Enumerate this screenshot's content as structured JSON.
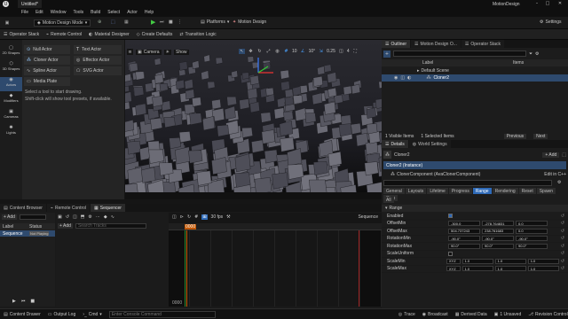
{
  "titlebar": {
    "tab": "Untitled*",
    "app_name": "MotionDesign"
  },
  "menu": [
    "File",
    "Edit",
    "Window",
    "Tools",
    "Build",
    "Select",
    "Actor",
    "Help"
  ],
  "toolbar1": {
    "mode": "Motion Design Mode",
    "platforms": "Platforms",
    "motion_design": "Motion Design",
    "settings": "Settings"
  },
  "toolbar2": {
    "items": [
      "Operator Stack",
      "Remote Control",
      "Material Designer",
      "Create Defaults",
      "Transition Logic"
    ]
  },
  "leftbar": [
    "2D Shapes",
    "3D Shapes",
    "Actors",
    "Modifiers",
    "Cameras",
    "Lights"
  ],
  "tools": {
    "items": [
      "Null Actor",
      "Text Actor",
      "Cloner Actor",
      "Effector Actor",
      "Spline Actor",
      "SVG Actor",
      "Media Plate"
    ],
    "hint1": "Select a tool to start drawing.",
    "hint2": "Shift-click will show tool presets, if available."
  },
  "viewport": {
    "camera": "Camera",
    "show": "Show",
    "snap1": "10",
    "snap2": "10°",
    "snap3": "0.25",
    "snap4": "4"
  },
  "outliner": {
    "tabs": [
      "Outliner",
      "Motion Design O...",
      "Operator Stack"
    ],
    "col_label": "Label",
    "col_items": "Items",
    "scene": "Default Scene",
    "item": "Cloner2",
    "footer_items": "1 Visible Items",
    "footer_sel": "1 Selected Items",
    "prev": "Previous",
    "next": "Next"
  },
  "details": {
    "tabs": [
      "Details",
      "World Settings"
    ],
    "actor": "Cloner2",
    "add": "+ Add",
    "instance": "Cloner2 (Instance)",
    "component": "ClonerComponent (AvaClonerComponent)",
    "edit_cpp": "Edit in C++",
    "cats": [
      "General",
      "Layouts",
      "Lifetime",
      "Progress",
      "Range",
      "Rendering",
      "Reset",
      "Spawn",
      "Step"
    ],
    "active_cat": "Range",
    "all": "All",
    "section": "Range",
    "props": [
      {
        "label": "Enabled",
        "values": []
      },
      {
        "label": "OffsetMin",
        "values": [
          "-300.0",
          "-278.764831",
          "0.0"
        ]
      },
      {
        "label": "OffsetMax",
        "values": [
          "504.737243",
          "238.761683",
          "0.0"
        ]
      },
      {
        "label": "RotationMin",
        "values": [
          "-90.0°",
          "-90.0°",
          "-90.0°"
        ]
      },
      {
        "label": "RotationMax",
        "values": [
          "90.0°",
          "90.0°",
          "90.0°"
        ]
      },
      {
        "label": "ScaleUniform",
        "values": []
      },
      {
        "label": "ScaleMin",
        "values": [
          "XYZ",
          "1.0",
          "1.0",
          "1.0"
        ]
      },
      {
        "label": "ScaleMax",
        "values": [
          "XYZ",
          "1.0",
          "1.0",
          "1.0"
        ]
      }
    ]
  },
  "bottom": {
    "tabs": [
      "Content Browser",
      "Remote Control",
      "Sequencer"
    ],
    "add": "+ Add",
    "col_label": "Label",
    "col_status": "Status",
    "seq_name": "Sequence",
    "seq_status": "Not Playing",
    "track_add": "+ Add",
    "search": "Search Tracks",
    "fps": "30 fps",
    "playhead": "0000",
    "seq_label": "Sequence",
    "counter": "0000"
  },
  "status": {
    "left": [
      "Content Drawer",
      "Output Log",
      "Cmd"
    ],
    "console": "Enter Console Command",
    "right": [
      "Trace",
      "Broadcast",
      "Derived Data",
      "1 Unsaved",
      "Revision Control"
    ]
  }
}
